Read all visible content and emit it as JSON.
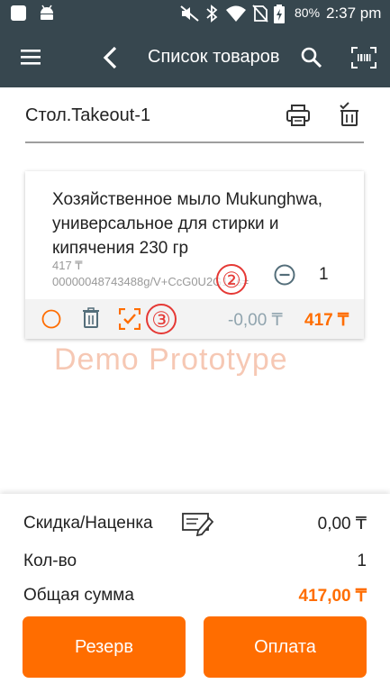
{
  "status_bar": {
    "battery_percent": "80%",
    "time": "2:37 pm",
    "icons": [
      "notification-square-icon",
      "android-icon",
      "mute-icon",
      "bluetooth-icon",
      "wifi-icon",
      "no-sim-icon",
      "battery-charging-icon"
    ]
  },
  "app_bar": {
    "title": "Список товаров",
    "icons": [
      "menu-icon",
      "back-arrow-icon",
      "search-icon",
      "barcode-scan-icon"
    ]
  },
  "order": {
    "name": "Стол.Takeout-1",
    "icons": [
      "print-icon",
      "delete-all-icon"
    ]
  },
  "item": {
    "name": "Хозяйственное мыло Mukunghwa, универсальное для стирки и кипячения 230 гр",
    "unit_price": "417 ₸",
    "barcode": "00000048743488g/V+CcG0U2G1Xs=",
    "quantity": "1",
    "discount": "-0,00 ₸",
    "total": "417 ₸",
    "icons": [
      "select-circle-icon",
      "trash-icon",
      "check-frame-icon",
      "minus-circle-icon"
    ]
  },
  "annotations": {
    "badge_2": "②",
    "badge_3": "③"
  },
  "watermark": "Demo Prototype",
  "summary": {
    "discount_label": "Скидка/Наценка",
    "discount_value": "0,00 ₸",
    "qty_label": "Кол-во",
    "qty_value": "1",
    "total_label": "Общая сумма",
    "total_value": "417,00 ₸"
  },
  "buttons": {
    "reserve": "Резерв",
    "pay": "Оплата"
  },
  "colors": {
    "toolbar": "#37474f",
    "accent": "#ff6d00",
    "badge": "#e53935",
    "watermark": "#f6c8b4"
  }
}
